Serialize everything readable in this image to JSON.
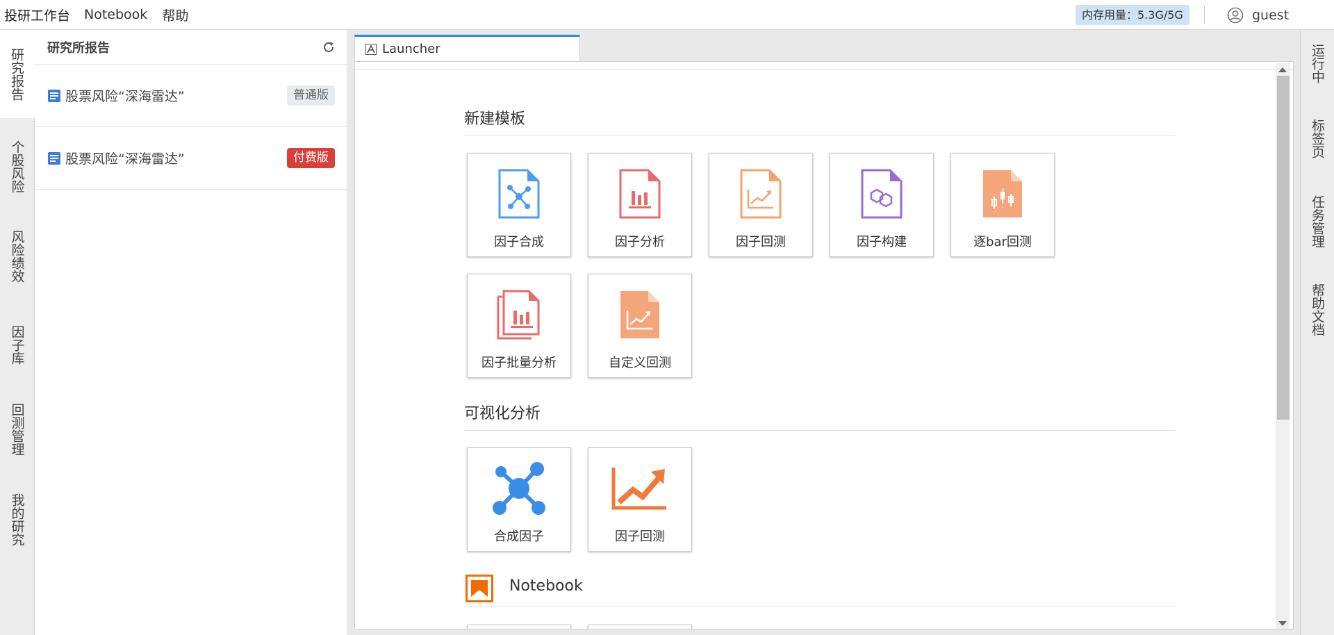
{
  "menubar": {
    "brand": "投研工作台",
    "menus": [
      "Notebook",
      "帮助"
    ],
    "memory": "内存用量：5.3G/5G",
    "user": "guest",
    "memory_bg": "#cfe3f6"
  },
  "left_tabs": [
    "研究报告",
    "个股风险",
    "风险绩效",
    "因子库",
    "回测管理",
    "我的研究"
  ],
  "left_panel": {
    "title": "研究所报告",
    "refresh_icon": "refresh-icon",
    "reports": [
      {
        "name": "股票风险“深海雷达”",
        "badge": "普通版",
        "badge_type": "normal"
      },
      {
        "name": "股票风险“深海雷达”",
        "badge": "付费版",
        "badge_type": "paid"
      }
    ]
  },
  "main_tab": {
    "label": "Launcher",
    "accent": "#2b8ae6"
  },
  "launcher": {
    "sections": [
      {
        "title": "新建模板",
        "items": [
          {
            "label": "因子合成",
            "icon": "factor-compose-doc-icon"
          },
          {
            "label": "因子分析",
            "icon": "factor-analysis-doc-icon"
          },
          {
            "label": "因子回测",
            "icon": "factor-backtest-doc-icon"
          },
          {
            "label": "因子构建",
            "icon": "factor-build-doc-icon"
          },
          {
            "label": "逐bar回测",
            "icon": "bar-backtest-doc-icon"
          },
          {
            "label": "因子批量分析",
            "icon": "factor-batch-analysis-doc-icon"
          },
          {
            "label": "自定义回测",
            "icon": "custom-backtest-doc-icon"
          }
        ]
      },
      {
        "title": "可视化分析",
        "items": [
          {
            "label": "合成因子",
            "icon": "network-nodes-icon"
          },
          {
            "label": "因子回测",
            "icon": "trend-up-chart-icon"
          }
        ]
      },
      {
        "title": "Notebook",
        "icon": "notebook-bookmark-icon"
      }
    ]
  },
  "right_tabs": [
    "运行中",
    "标签页",
    "任务管理",
    "帮助文档"
  ]
}
